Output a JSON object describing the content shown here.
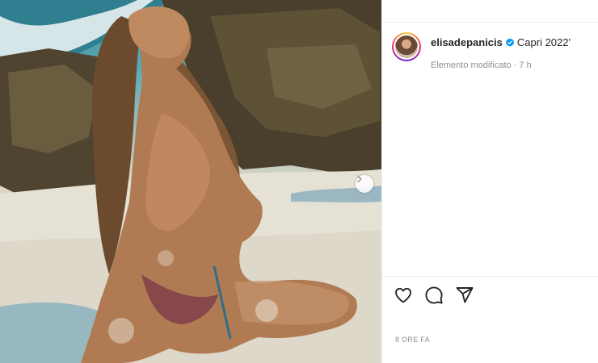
{
  "post": {
    "username": "elisadepanicis",
    "caption": "Capri 2022'",
    "meta_line": "Elemento modificato · 7 h",
    "time_ago": "8 ORE FA"
  },
  "icons": {
    "verified": "verified-badge-icon",
    "like": "heart-icon",
    "comment": "comment-icon",
    "share": "paper-plane-icon",
    "next": "chevron-right-icon"
  },
  "colors": {
    "verified_blue": "#0095f6",
    "text": "#262626",
    "muted": "#8e8e8e",
    "divider": "#efefef"
  }
}
